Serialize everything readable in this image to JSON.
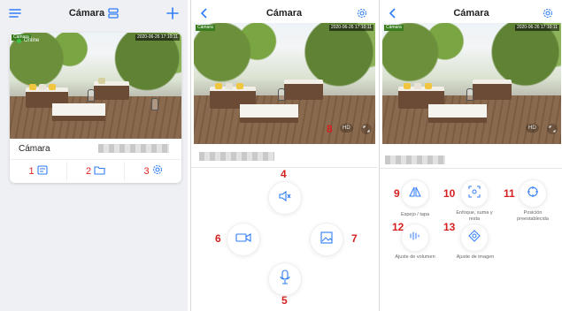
{
  "panel_list": {
    "title": "Cámara",
    "camera_name": "Cámara",
    "status": "Online",
    "stamp_left": "Cámara",
    "stamp_right": "2020-06-26 17:10:11",
    "actions": [
      {
        "num": "1",
        "icon": "playback-icon"
      },
      {
        "num": "2",
        "icon": "folder-icon"
      },
      {
        "num": "3",
        "icon": "gear-icon"
      }
    ]
  },
  "panel_live": {
    "title": "Cámara",
    "stamp_left": "Cámara",
    "stamp_right": "2020-06-26 17:10:11",
    "hd": "HD",
    "marker_8": "8",
    "controls": [
      {
        "num": "4",
        "icon": "speaker-mute-icon"
      },
      {
        "num": "6",
        "icon": "record-video-icon"
      },
      {
        "num": "7",
        "icon": "snapshot-icon"
      },
      {
        "num": "5",
        "icon": "microphone-icon"
      }
    ]
  },
  "panel_ptz": {
    "title": "Cámara",
    "stamp_left": "Cámara",
    "stamp_right": "2020-06-26 17:10:11",
    "hd": "HD",
    "controls": [
      {
        "num": "9",
        "label": "Espejo / tapa",
        "icon": "mirror-flip-icon"
      },
      {
        "num": "10",
        "label": "Enfoque, suma y resta",
        "icon": "focus-icon"
      },
      {
        "num": "11",
        "label": "Posición preestablecida",
        "icon": "preset-position-icon"
      },
      {
        "num": "12",
        "label": "Ajuste de volumen",
        "icon": "volume-adjust-icon"
      },
      {
        "num": "13",
        "label": "Ajuste de imagen",
        "icon": "image-adjust-icon"
      }
    ]
  },
  "colors": {
    "accent": "#2f7df6",
    "marker": "#e02020",
    "online": "#3ac24b"
  }
}
